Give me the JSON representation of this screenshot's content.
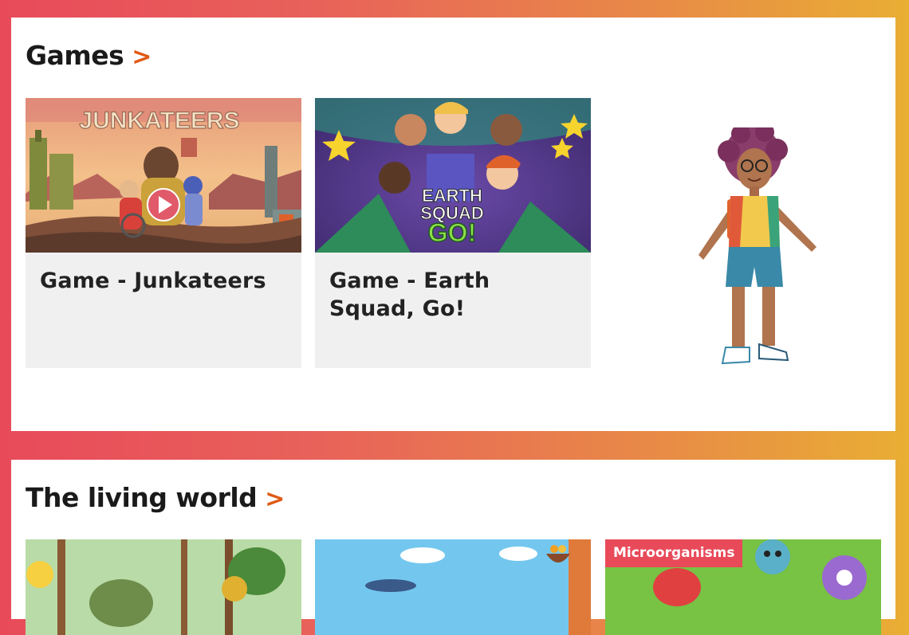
{
  "colors": {
    "accent": "#e05a14",
    "tag_bg": "#e84a5a",
    "card_body": "#f0f0f0"
  },
  "games": {
    "heading": "Games",
    "chevron": ">",
    "cards": [
      {
        "title": "Game - Junkateers",
        "logo": "JUNKATEERS",
        "icon": "play-icon"
      },
      {
        "title": "Game - Earth Squad, Go!",
        "logo_line1": "EARTH",
        "logo_line2": "SQUAD",
        "logo_line3": "GO!"
      }
    ]
  },
  "living_world": {
    "heading": "The living world",
    "chevron": ">",
    "cards": [
      {
        "tag": ""
      },
      {
        "tag": ""
      },
      {
        "tag": "Microorganisms"
      }
    ]
  }
}
